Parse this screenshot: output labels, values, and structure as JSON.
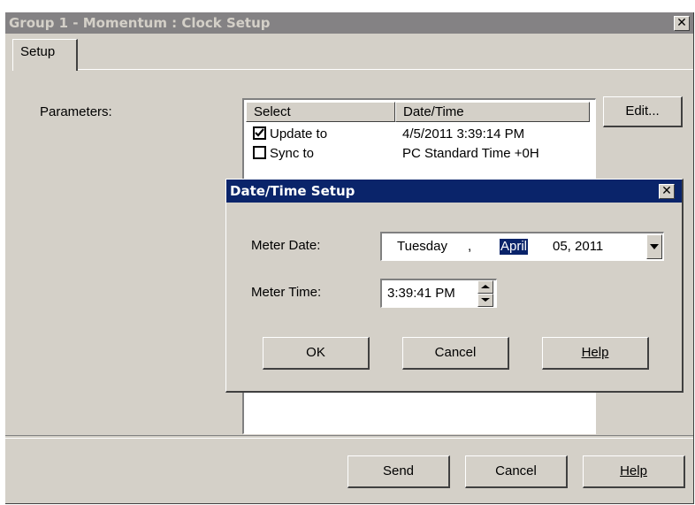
{
  "window": {
    "title": "Group 1 - Momentum : Clock Setup",
    "close_glyph": "✕"
  },
  "tabs": [
    {
      "label": "Setup"
    }
  ],
  "parameters": {
    "label": "Parameters:",
    "edit_label": "Edit...",
    "columns": [
      "Select",
      "Date/Time"
    ],
    "rows": [
      {
        "label": "Update to",
        "value": "4/5/2011 3:39:14 PM",
        "checked": true
      },
      {
        "label": "Sync to",
        "value": "PC Standard Time +0H",
        "checked": false
      }
    ]
  },
  "dialog": {
    "title": "Date/Time Setup",
    "close_glyph": "✕",
    "meter_date_label": "Meter Date:",
    "date": {
      "weekday": "Tuesday",
      "sep": ",",
      "month": "April",
      "day_year": "05, 2011"
    },
    "meter_time_label": "Meter Time:",
    "time": "3:39:41 PM",
    "ok_label": "OK",
    "cancel_label": "Cancel",
    "help_label": "Help"
  },
  "footer": {
    "send_label": "Send",
    "cancel_label": "Cancel",
    "help_label": "Help"
  }
}
